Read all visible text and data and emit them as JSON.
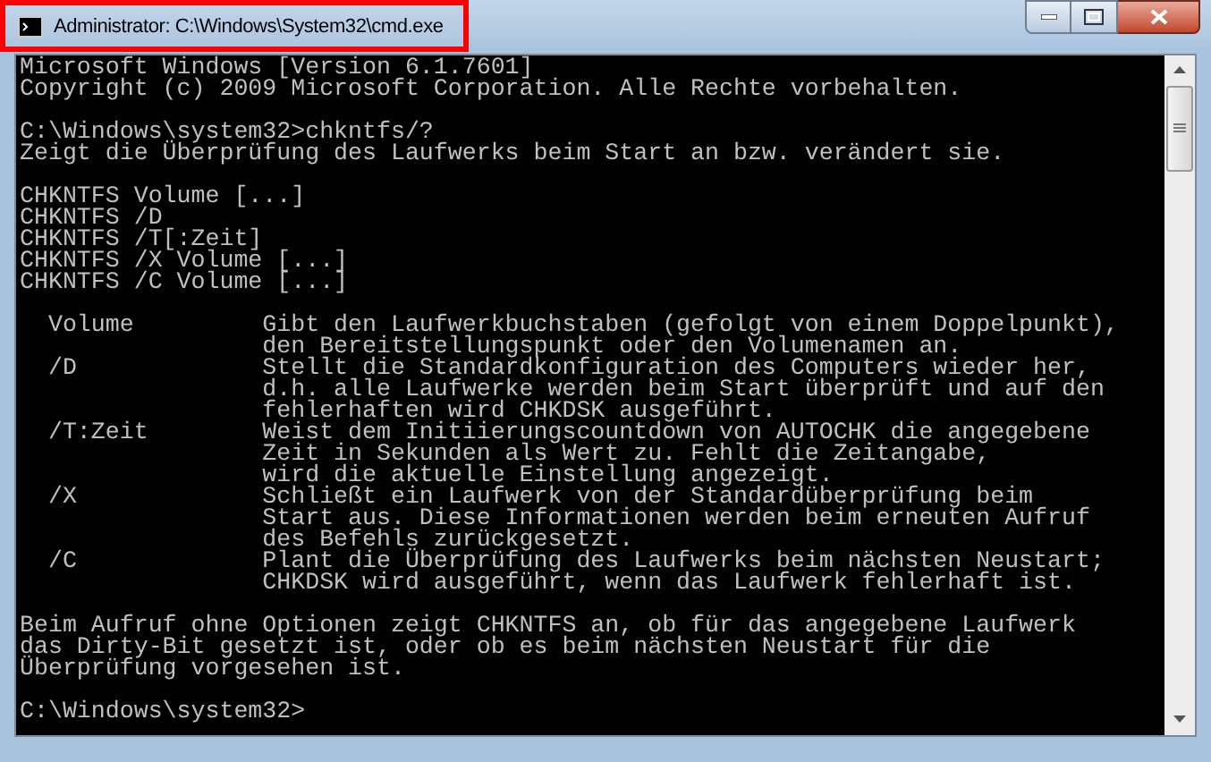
{
  "window": {
    "title": "Administrator: C:\\Windows\\System32\\cmd.exe",
    "highlighted": true
  },
  "console": {
    "blocks": [
      [
        "Microsoft Windows [Version 6.1.7601]",
        "Copyright (c) 2009 Microsoft Corporation. Alle Rechte vorbehalten."
      ],
      [
        "C:\\Windows\\system32>chkntfs/?",
        "Zeigt die Überprüfung des Laufwerks beim Start an bzw. verändert sie."
      ],
      [
        "CHKNTFS Volume [...]",
        "CHKNTFS /D",
        "CHKNTFS /T[:Zeit]",
        "CHKNTFS /X Volume [...]",
        "CHKNTFS /C Volume [...]"
      ],
      [
        "  Volume         Gibt den Laufwerkbuchstaben (gefolgt von einem Doppelpunkt),",
        "                 den Bereitstellungspunkt oder den Volumenamen an.",
        "  /D             Stellt die Standardkonfiguration des Computers wieder her,",
        "                 d.h. alle Laufwerke werden beim Start überprüft und auf den",
        "                 fehlerhaften wird CHKDSK ausgeführt.",
        "  /T:Zeit        Weist dem Initiierungscountdown von AUTOCHK die angegebene",
        "                 Zeit in Sekunden als Wert zu. Fehlt die Zeitangabe,",
        "                 wird die aktuelle Einstellung angezeigt.",
        "  /X             Schließt ein Laufwerk von der Standardüberprüfung beim",
        "                 Start aus. Diese Informationen werden beim erneuten Aufruf",
        "                 des Befehls zurückgesetzt.",
        "  /C             Plant die Überprüfung des Laufwerks beim nächsten Neustart;",
        "                 CHKDSK wird ausgeführt, wenn das Laufwerk fehlerhaft ist."
      ],
      [
        "Beim Aufruf ohne Optionen zeigt CHKNTFS an, ob für das angegebene Laufwerk",
        "das Dirty-Bit gesetzt ist, oder ob es beim nächsten Neustart für die",
        "Überprüfung vorgesehen ist."
      ],
      [
        "C:\\Windows\\system32>"
      ]
    ]
  }
}
